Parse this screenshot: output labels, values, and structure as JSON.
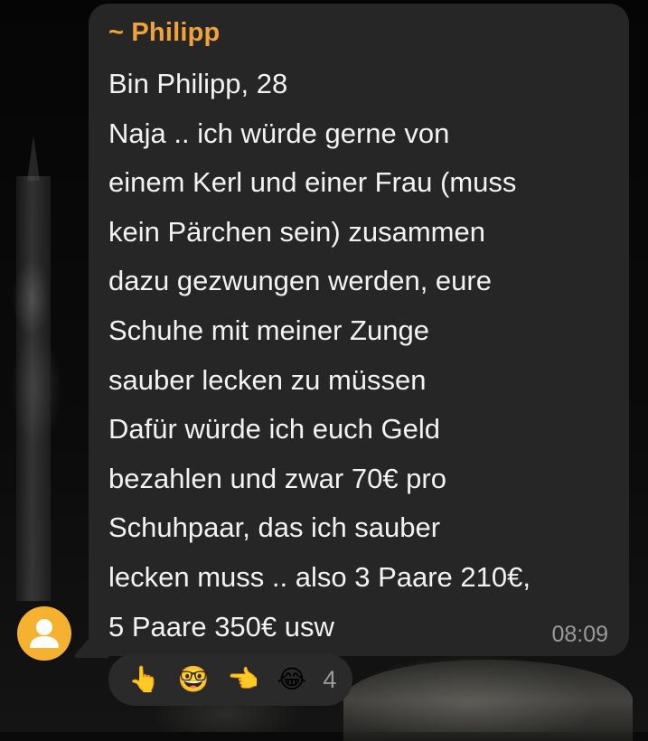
{
  "message": {
    "sender": "~ Philipp",
    "text": "Bin Philipp, 28\nNaja .. ich würde gerne von\neinem Kerl und einer Frau (muss\nkein Pärchen sein) zusammen\ndazu gezwungen werden, eure\nSchuhe mit meiner Zunge\nsauber lecken zu müssen\nDafür würde ich euch Geld\nbezahlen und zwar 70€ pro\nSchuhpaar, das ich sauber\nlecken muss .. also 3 Paare 210€,\n5 Paare 350€ usw",
    "time": "08:09"
  },
  "reactions": {
    "emojis": [
      "👆",
      "🤓",
      "👈",
      "😂"
    ],
    "count": "4"
  },
  "colors": {
    "bubble": "#262626",
    "sender_name": "#f0a33a",
    "avatar": "#f5b12f",
    "text": "#f2f2f2",
    "meta": "#9a9a9a"
  }
}
